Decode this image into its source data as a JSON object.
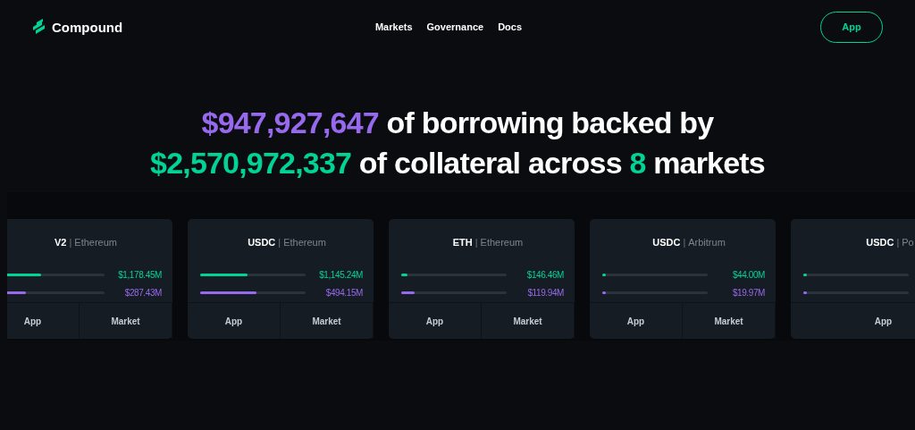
{
  "brand": {
    "name": "Compound"
  },
  "nav": [
    {
      "label": "Markets"
    },
    {
      "label": "Governance"
    },
    {
      "label": "Docs"
    }
  ],
  "app_button": "App",
  "headline": [
    [
      {
        "text": "$947,927,647",
        "kind": "borrow"
      },
      {
        "text": " of borrowing backed by",
        "kind": "plain"
      }
    ],
    [
      {
        "text": "$2,570,972,337",
        "kind": "supply"
      },
      {
        "text": " of collateral across ",
        "kind": "plain"
      },
      {
        "text": "8",
        "kind": "supply"
      },
      {
        "text": " markets",
        "kind": "plain"
      }
    ]
  ],
  "markets": [
    {
      "asset": "V2",
      "separator": "|",
      "network": "Ethereum",
      "supply": {
        "level": 0.4,
        "value": "$1,178.45M"
      },
      "borrow": {
        "level": 0.25,
        "value": "$287.43M"
      },
      "buttons": [
        "App",
        "Market"
      ]
    },
    {
      "asset": "USDC",
      "separator": "|",
      "network": "Ethereum",
      "supply": {
        "level": 0.45,
        "value": "$1,145.24M"
      },
      "borrow": {
        "level": 0.53,
        "value": "$494.15M"
      },
      "buttons": [
        "App",
        "Market"
      ]
    },
    {
      "asset": "ETH",
      "separator": "|",
      "network": "Ethereum",
      "supply": {
        "level": 0.06,
        "value": "$146.46M"
      },
      "borrow": {
        "level": 0.13,
        "value": "$119.94M"
      },
      "buttons": [
        "App",
        "Market"
      ]
    },
    {
      "asset": "USDC",
      "separator": "|",
      "network": "Arbitrum",
      "supply": {
        "level": 0.015,
        "value": "$44.00M"
      },
      "borrow": {
        "level": 0.015,
        "value": "$19.97M"
      },
      "buttons": [
        "App",
        "Market"
      ]
    },
    {
      "asset": "USDC",
      "separator": "|",
      "network": "Po",
      "supply": {
        "level": 0.015
      },
      "borrow": {
        "level": 0.015
      },
      "buttons": [
        "App"
      ]
    }
  ]
}
